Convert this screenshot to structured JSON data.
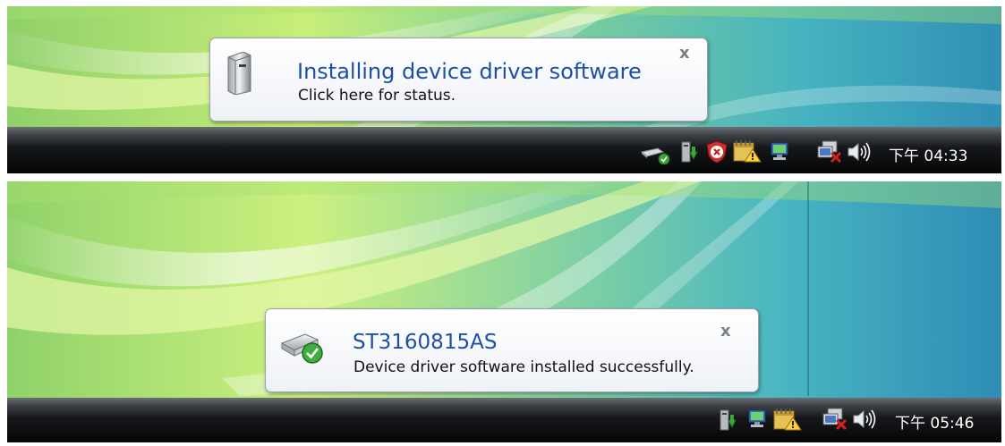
{
  "panels": [
    {
      "balloon": {
        "title": "Installing device driver software",
        "message": "Click here for status.",
        "icon": "hard-drive-icon",
        "close_label": "x"
      },
      "tray": {
        "icons": [
          "removable-device-check-icon",
          "driver-install-icon",
          "security-center-alert-icon",
          "calendar-warning-icon",
          "network-icon",
          "network-disconnected-icon",
          "speaker-icon"
        ],
        "clock": "下午 04:33"
      }
    },
    {
      "balloon": {
        "title": "ST3160815AS",
        "message": "Device driver software installed successfully.",
        "icon": "disk-drive-success-icon",
        "close_label": "x"
      },
      "tray": {
        "icons": [
          "driver-install-icon",
          "network-icon",
          "calendar-warning-icon",
          "network-disconnected-icon",
          "speaker-icon"
        ],
        "clock": "下午 05:46"
      }
    }
  ],
  "colors": {
    "balloon_title": "#1f4fa5",
    "taskbar_top": "#6b6f74",
    "taskbar_bottom": "#050607",
    "desktop_green": "#b7e84a",
    "desktop_teal": "#2e9fb0"
  }
}
